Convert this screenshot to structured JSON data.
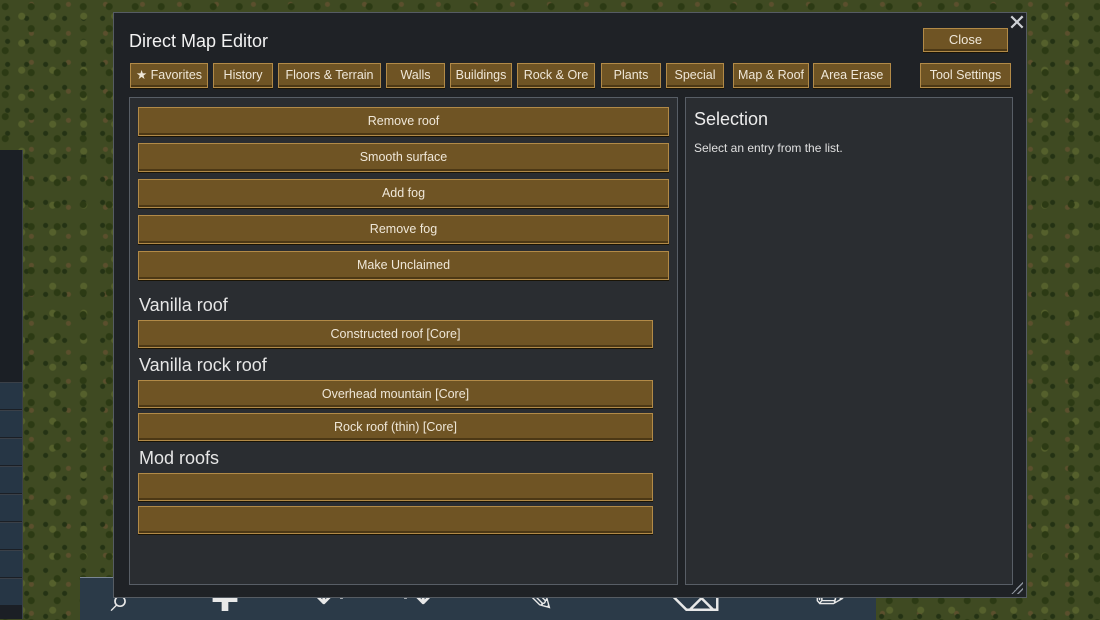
{
  "window": {
    "title": "Direct Map Editor",
    "close_label": "Close"
  },
  "tabs": [
    {
      "label": "★ Favorites"
    },
    {
      "label": "History"
    },
    {
      "label": "Floors & Terrain"
    },
    {
      "label": "Walls"
    },
    {
      "label": "Buildings"
    },
    {
      "label": "Rock & Ore"
    },
    {
      "label": "Plants"
    },
    {
      "label": "Special"
    },
    {
      "label": "Map & Roof"
    },
    {
      "label": "Area Erase"
    }
  ],
  "tool_settings_label": "Tool Settings",
  "list": {
    "actions": [
      {
        "label": "Remove roof"
      },
      {
        "label": "Smooth surface"
      },
      {
        "label": "Add fog"
      },
      {
        "label": "Remove fog"
      },
      {
        "label": "Make Unclaimed"
      }
    ],
    "sections": [
      {
        "title": "Vanilla roof",
        "items": [
          {
            "label": "Constructed roof  [Core]"
          }
        ]
      },
      {
        "title": "Vanilla rock roof",
        "items": [
          {
            "label": "Overhead mountain  [Core]"
          },
          {
            "label": "Rock roof (thin)  [Core]"
          }
        ]
      },
      {
        "title": "Mod roofs",
        "items": [
          {
            "label": ""
          },
          {
            "label": ""
          }
        ]
      }
    ]
  },
  "selection": {
    "title": "Selection",
    "text": "Select an entry from the list."
  },
  "colors": {
    "button_fill": "#6f5424",
    "button_border": "#b28a47",
    "window_bg": "#1f2226",
    "panel_bg": "#2a2d31"
  }
}
